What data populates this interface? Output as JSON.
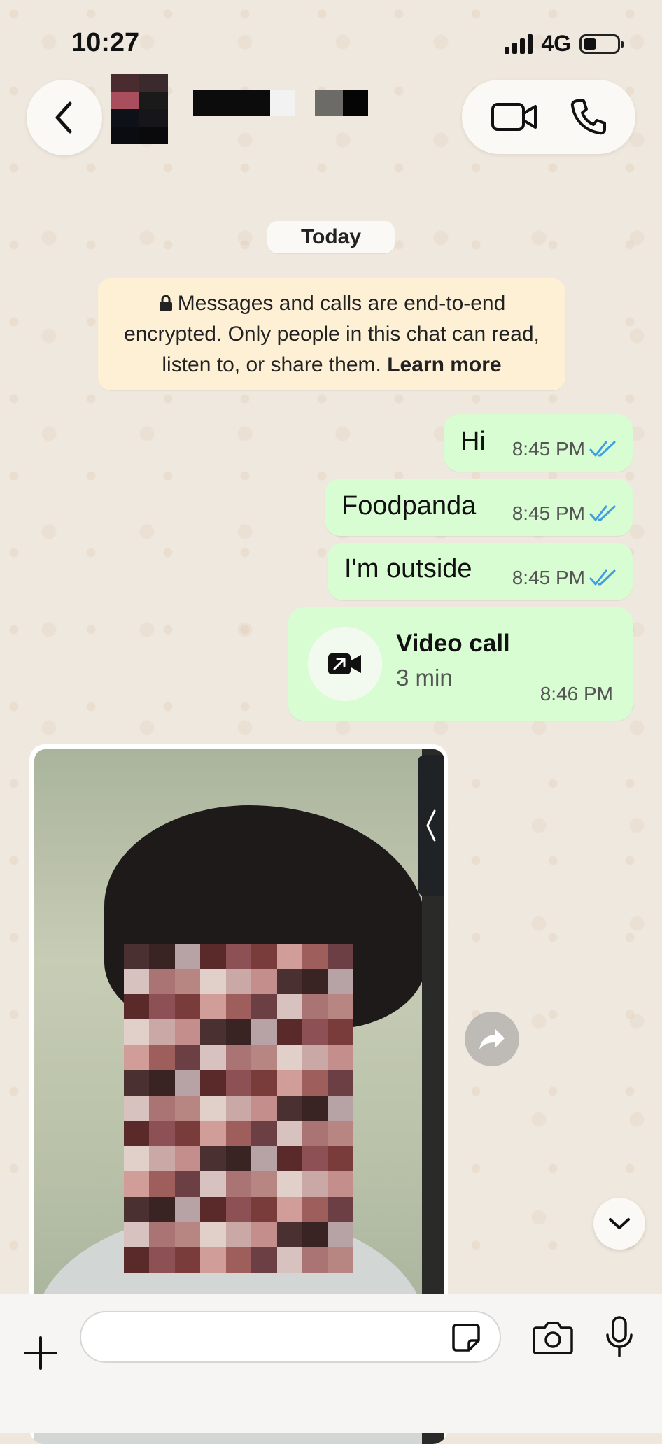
{
  "status_bar": {
    "time": "10:27",
    "network": "4G",
    "battery_percent": 25
  },
  "header": {
    "back_icon": "chevron-left-icon",
    "video_call_icon": "video-camera-icon",
    "voice_call_icon": "phone-icon"
  },
  "chat": {
    "date_label": "Today",
    "encryption_notice": {
      "text": "Messages and calls are end-to-end encrypted. Only people in this chat can read, listen to, or share them.",
      "link": "Learn more"
    },
    "messages": [
      {
        "text": "Hi",
        "time": "8:45 PM",
        "status": "read"
      },
      {
        "text": "Foodpanda",
        "time": "8:45 PM",
        "status": "read"
      },
      {
        "text": "I'm outside",
        "time": "8:45 PM",
        "status": "read"
      }
    ],
    "video_call": {
      "title": "Video call",
      "duration": "3 min",
      "time": "8:46 PM"
    }
  },
  "input": {
    "placeholder": "",
    "value": ""
  },
  "colors": {
    "outgoing_bubble": "#d9fdd3",
    "read_tick": "#53bdeb",
    "notice_bg": "#fdf0d5",
    "wallpaper": "#efe8de"
  }
}
